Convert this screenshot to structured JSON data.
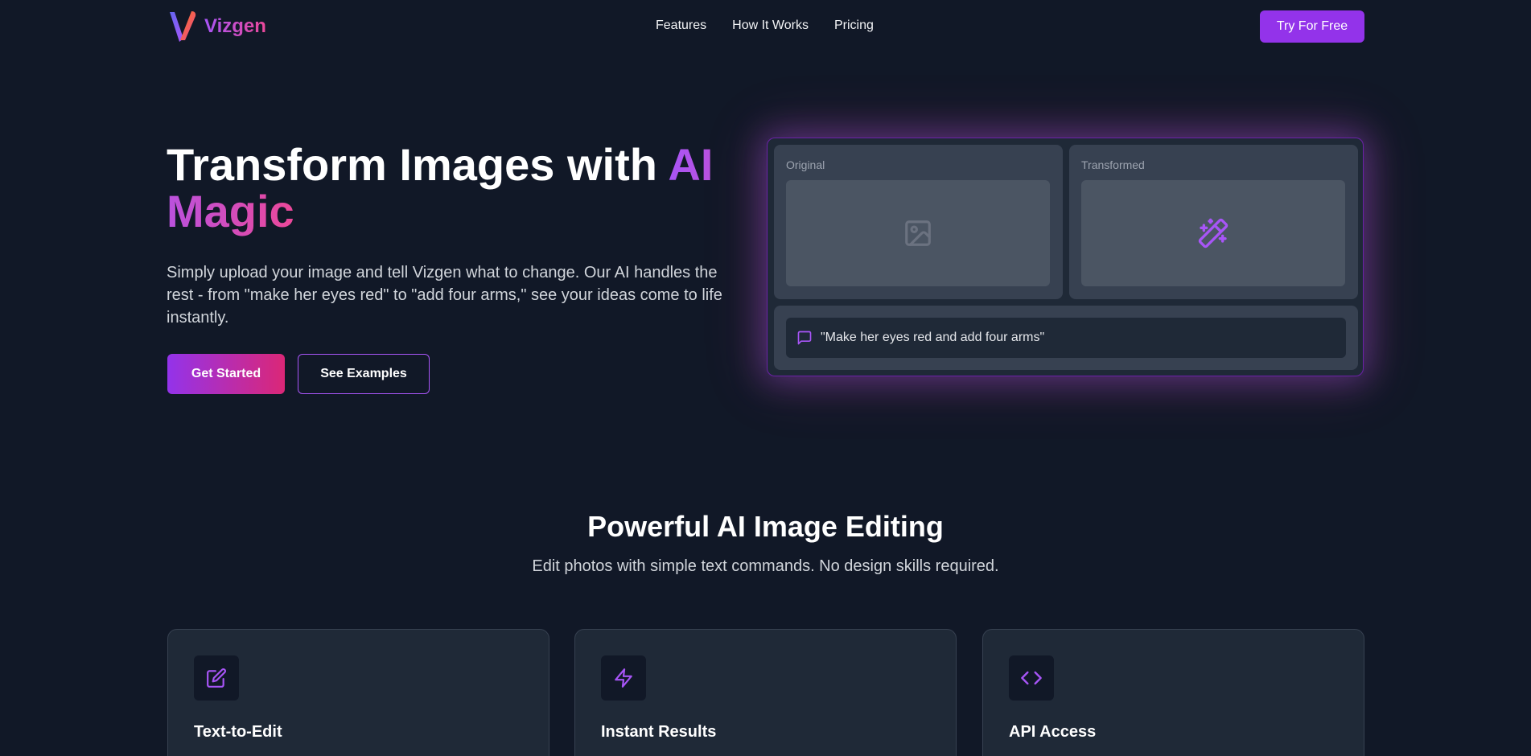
{
  "brand": {
    "name": "Vizgen"
  },
  "nav": {
    "links": [
      "Features",
      "How It Works",
      "Pricing"
    ],
    "cta": "Try For Free"
  },
  "hero": {
    "title_plain": "Transform Images with ",
    "title_highlight": "AI Magic",
    "description": "Simply upload your image and tell Vizgen what to change. Our AI handles the rest - from \"make her eyes red\" to \"add four arms,\" see your ideas come to life instantly.",
    "primary_button": "Get Started",
    "secondary_button": "See Examples"
  },
  "demo": {
    "original_label": "Original",
    "transformed_label": "Transformed",
    "prompt": "\"Make her eyes red and add four arms\"",
    "icons": [
      "image-icon",
      "magic-wand-icon",
      "chat-bubble-icon"
    ]
  },
  "features": {
    "title": "Powerful AI Image Editing",
    "subtitle": "Edit photos with simple text commands. No design skills required.",
    "cards": [
      {
        "title": "Text-to-Edit",
        "icon": "edit-icon"
      },
      {
        "title": "Instant Results",
        "icon": "lightning-icon"
      },
      {
        "title": "API Access",
        "icon": "code-icon"
      }
    ]
  },
  "colors": {
    "background": "#111827",
    "surface": "#1f2937",
    "accent_purple": "#a855f7",
    "accent_pink": "#ec4899",
    "button_purple": "#9333ea"
  }
}
